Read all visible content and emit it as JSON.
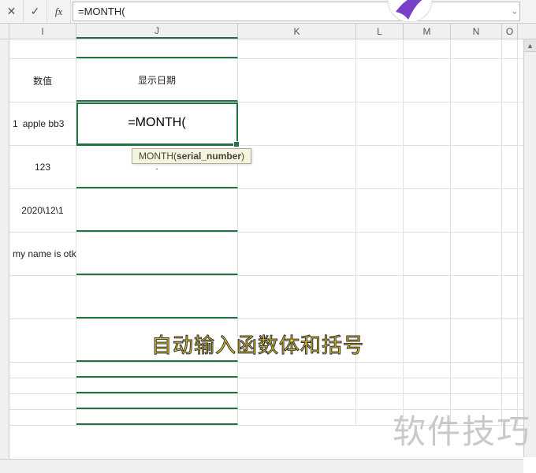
{
  "formula_bar": {
    "cancel_glyph": "✕",
    "accept_glyph": "✓",
    "fx_label": "fx",
    "value": "=MONTH(",
    "expand_glyph": "⌄"
  },
  "columns": {
    "I": "I",
    "J": "J",
    "K": "K",
    "L": "L",
    "M": "M",
    "N": "N",
    "O": "O"
  },
  "cells": {
    "header_I": "数值",
    "header_J": "显示日期",
    "row1_num": "1",
    "row1_I": "apple bb3",
    "row1_J": "=MONTH(",
    "row2_I": "123",
    "row2_J": ".",
    "row3_I": "2020\\12\\1",
    "row4_I": "my name is otk"
  },
  "tooltip": {
    "fn": "MONTH",
    "arg": "serial_number",
    "open": "(",
    "close": ")"
  },
  "annotation": "自动输入函数体和括号",
  "watermark": "软件技巧",
  "scrollbar": {
    "up": "▲"
  }
}
